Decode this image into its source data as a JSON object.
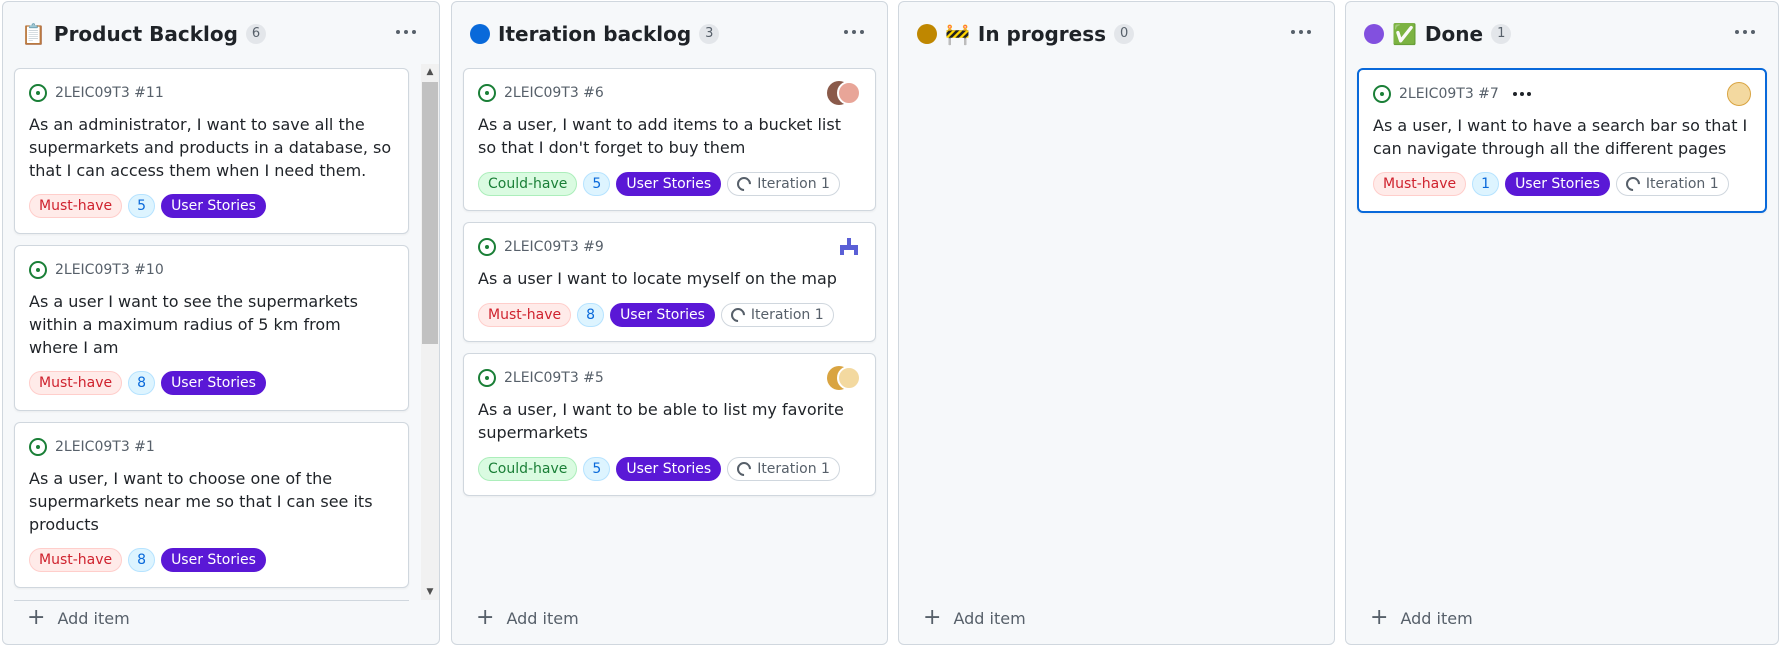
{
  "columns": [
    {
      "title": "Product Backlog",
      "emoji": "📋",
      "count": "6",
      "add_label": "Add item",
      "cards": [
        {
          "ref": "2LEIC09T3 #11",
          "title": "As an administrator, I want to save all the supermarkets and products in a database, so that I can access them when I need them.",
          "priority": "Must-have",
          "points": "5",
          "type": "User Stories"
        },
        {
          "ref": "2LEIC09T3 #10",
          "title": "As a user I want to see the supermarkets within a maximum radius of 5 km from where I am",
          "priority": "Must-have",
          "points": "8",
          "type": "User Stories"
        },
        {
          "ref": "2LEIC09T3 #1",
          "title": "As a user, I want to choose one of the supermarkets near me so that I can see its products",
          "priority": "Must-have",
          "points": "8",
          "type": "User Stories"
        }
      ]
    },
    {
      "title": "Iteration backlog",
      "status_color": "#0969da",
      "count": "3",
      "add_label": "Add item",
      "cards": [
        {
          "ref": "2LEIC09T3 #6",
          "title": "As a user, I want to add items to a bucket list so that I don't forget to buy them",
          "priority": "Could-have",
          "points": "5",
          "type": "User Stories",
          "iteration": "Iteration 1"
        },
        {
          "ref": "2LEIC09T3 #9",
          "title": "As a user I want to locate myself on the map",
          "priority": "Must-have",
          "points": "8",
          "type": "User Stories",
          "iteration": "Iteration 1"
        },
        {
          "ref": "2LEIC09T3 #5",
          "title": "As a user, I want to be able to list my favorite supermarkets",
          "priority": "Could-have",
          "points": "5",
          "type": "User Stories",
          "iteration": "Iteration 1"
        }
      ]
    },
    {
      "title": "In progress",
      "status_color": "#bf8700",
      "emoji": "🚧",
      "count": "0",
      "add_label": "Add item"
    },
    {
      "title": "Done",
      "status_color": "#8250df",
      "emoji": "✅",
      "count": "1",
      "add_label": "Add item",
      "cards": [
        {
          "ref": "2LEIC09T3 #7",
          "title": "As a user, I want to have a search bar so that I can navigate through all the different pages",
          "priority": "Must-have",
          "points": "1",
          "type": "User Stories",
          "iteration": "Iteration 1"
        }
      ]
    }
  ],
  "colors": {
    "must_have": "#cf222e",
    "could_have": "#1a7f37",
    "user_stories": "#5a18d6",
    "selected_border": "#0969da"
  }
}
